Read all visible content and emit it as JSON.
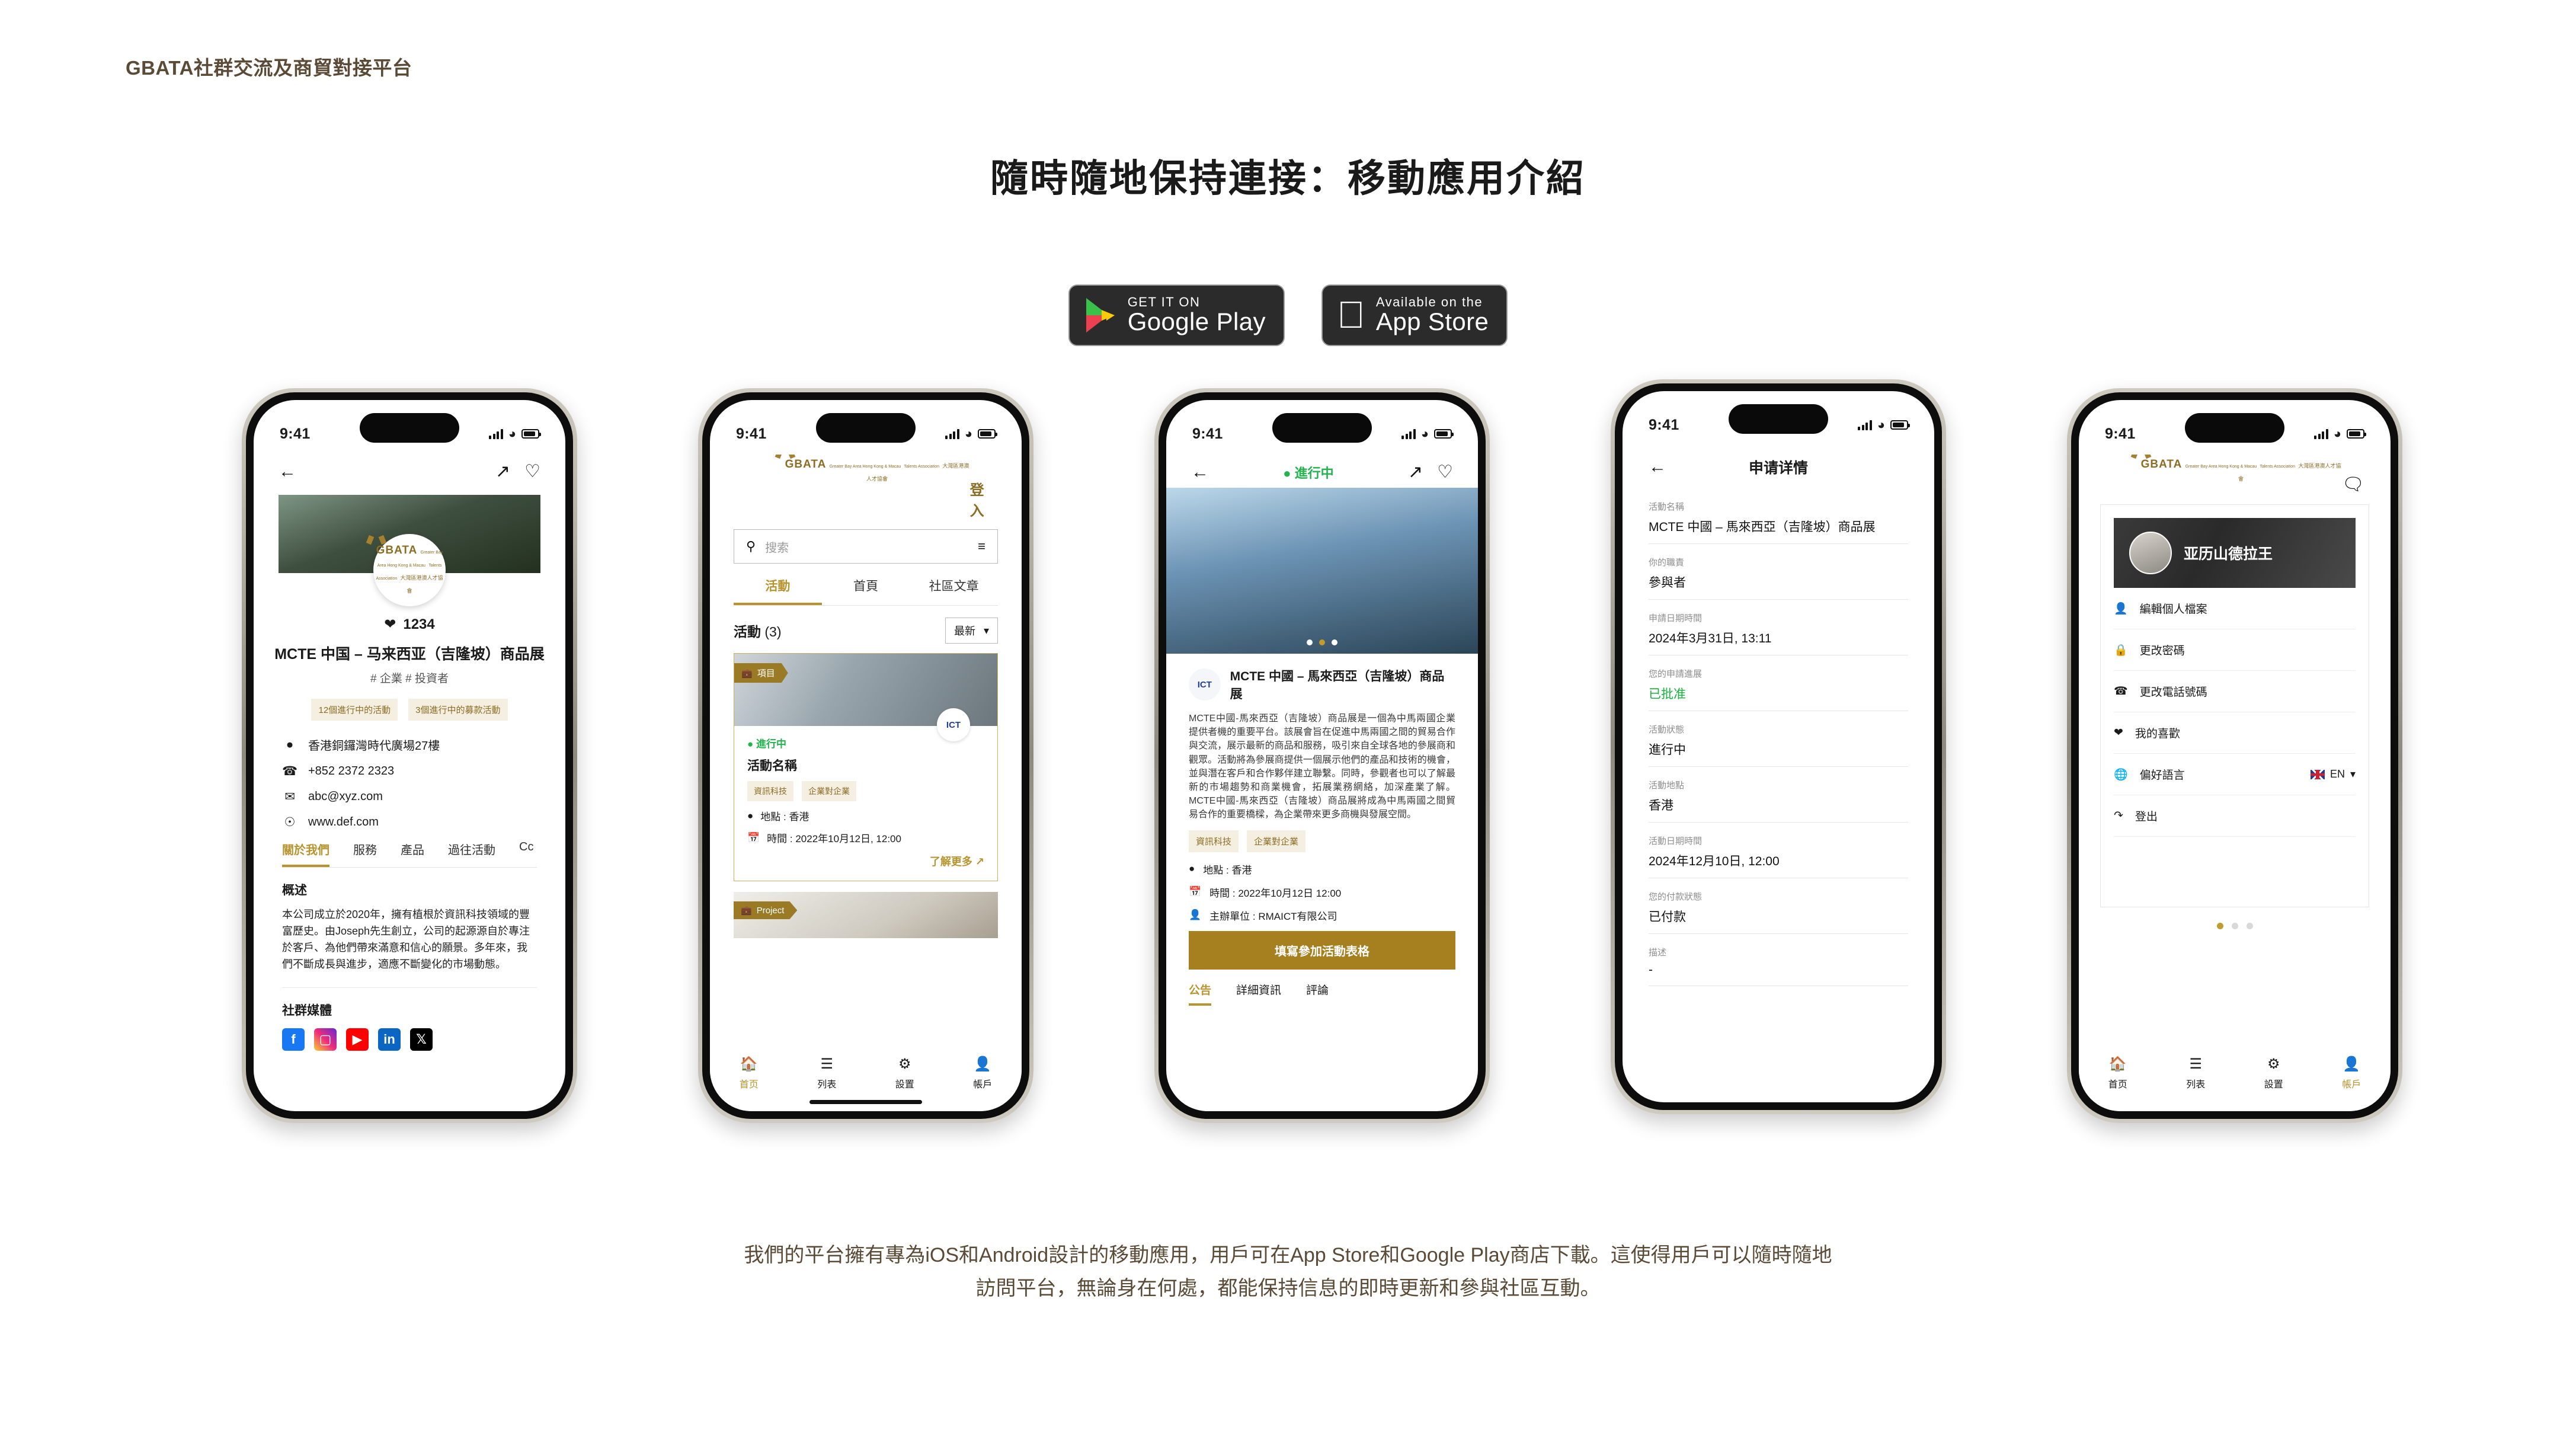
{
  "header": {
    "brand": "GBATA社群交流及商貿對接平台"
  },
  "title": "隨時隨地保持連接：移動應用介紹",
  "badges": {
    "google": {
      "small": "GET IT ON",
      "big": "Google Play"
    },
    "apple": {
      "small": "Available on the",
      "big": "App Store"
    }
  },
  "colors": {
    "brand_brown": "#5a4a36",
    "gold": "#b8942f",
    "gold_dark": "#a6801f",
    "green": "#22b44c"
  },
  "status_bar": {
    "time": "9:41"
  },
  "logo": {
    "name": "GBATA",
    "sub_line1": "Greater Bay Area Hong Kong & Macau",
    "sub_line2": "Talents Association",
    "cn": "大灣區港澳人才協會"
  },
  "phone1": {
    "likes": "1234",
    "org_title": "MCTE 中国 – 马来西亚（吉隆坡）商品展",
    "org_tags": "# 企業  # 投資者",
    "chips": [
      "12個進行中的活動",
      "3個進行中的募款活動"
    ],
    "info": [
      {
        "icon": "location-icon",
        "text": "香港銅鑼灣時代廣場27樓"
      },
      {
        "icon": "phone-icon",
        "text": "+852 2372 2323"
      },
      {
        "icon": "mail-icon",
        "text": "abc@xyz.com"
      },
      {
        "icon": "globe-icon",
        "text": "www.def.com"
      }
    ],
    "tabs": [
      "關於我們",
      "服務",
      "產品",
      "過往活動",
      "Cc"
    ],
    "section_overview": "概述",
    "overview_text": "本公司成立於2020年，擁有植根於資訊科技領域的豐富歷史。由Joseph先生創立，公司的起源源自於專注於客戶、為他們帶來滿意和信心的願景。多年來，我們不斷成長與進步，適應不斷變化的市場動態。",
    "section_social": "社群媒體",
    "socials": [
      "facebook-icon",
      "instagram-icon",
      "youtube-icon",
      "linkedin-icon",
      "x-icon"
    ]
  },
  "phone2": {
    "login": "登入",
    "search_placeholder": "搜索",
    "tabs": [
      "活動",
      "首頁",
      "社區文章"
    ],
    "list_title": "活動",
    "list_count": "(3)",
    "sort_label": "最新",
    "card": {
      "ribbon": "項目",
      "status": "進行中",
      "title": "活動名稱",
      "chips": [
        "資訊科技",
        "企業對企業"
      ],
      "location": "地點 : 香港",
      "time": "時間 : 2022年10月12日, 12:00",
      "more": "了解更多"
    },
    "card2_ribbon": "Project",
    "tabbar": [
      "首页",
      "列表",
      "設置",
      "帳戶"
    ]
  },
  "phone3": {
    "status": "進行中",
    "event_title": "MCTE 中國 – 馬來西亞（吉隆坡）商品展",
    "description": "MCTE中國-馬來西亞（吉隆坡）商品展是一個為中馬兩國企業提供者機的重要平台。該展會旨在促進中馬兩國之間的貿易合作與交流，展示最新的商品和服務，吸引來自全球各地的參展商和觀眾。活動將為參展商提供一個展示他們的產品和技術的機會，並與潛在客戶和合作夥伴建立聯繫。同時，參觀者也可以了解最新的市場趨勢和商業機會，拓展業務網絡，加深產業了解。MCTE中國-馬來西亞（吉隆坡）商品展將成為中馬兩國之間貿易合作的重要橋樑，為企業帶來更多商機與發展空間。",
    "chips": [
      "資訊科技",
      "企業對企業"
    ],
    "rows": [
      {
        "icon": "location-icon",
        "text": "地點 : 香港"
      },
      {
        "icon": "calendar-icon",
        "text": "時間 : 2022年10月12日 12:00"
      },
      {
        "icon": "person-icon",
        "text": "主辦單位 : RMAICT有限公司"
      }
    ],
    "cta": "填寫參加活動表格",
    "tabs": [
      "公告",
      "詳細資訊",
      "評論"
    ]
  },
  "phone4": {
    "title": "申请详情",
    "fields": [
      {
        "label": "活動名稱",
        "value": "MCTE 中國 – 馬來西亞（吉隆坡）商品展",
        "green": false
      },
      {
        "label": "你的職責",
        "value": "參與者",
        "green": false
      },
      {
        "label": "申請日期時間",
        "value": "2024年3月31日, 13:11",
        "green": false
      },
      {
        "label": "您的申請進展",
        "value": "已批准",
        "green": true
      },
      {
        "label": "活動狀態",
        "value": "進行中",
        "green": false
      },
      {
        "label": "活動地點",
        "value": "香港",
        "green": false
      },
      {
        "label": "活動日期時間",
        "value": "2024年12月10日, 12:00",
        "green": false
      },
      {
        "label": "您的付款狀態",
        "value": "已付款",
        "green": false
      },
      {
        "label": "描述",
        "value": "-",
        "green": false
      }
    ]
  },
  "phone5": {
    "user_name": "亚历山德拉王",
    "items": [
      {
        "icon": "person-icon",
        "label": "編輯個人檔案",
        "right": ""
      },
      {
        "icon": "lock-icon",
        "label": "更改密碼",
        "right": ""
      },
      {
        "icon": "phone-icon",
        "label": "更改電話號碼",
        "right": ""
      },
      {
        "icon": "heart-icon",
        "label": "我的喜歡",
        "right": ""
      },
      {
        "icon": "translate-icon",
        "label": "偏好語言",
        "right": "EN"
      },
      {
        "icon": "logout-icon",
        "label": "登出",
        "right": ""
      }
    ],
    "tabbar": [
      "首页",
      "列表",
      "設置",
      "帳戶"
    ]
  },
  "caption": {
    "line1": "我們的平台擁有專為iOS和Android設計的移動應用，用戶可在App Store和Google Play商店下載。這使得用戶可以隨時隨地",
    "line2": "訪問平台，無論身在何處，都能保持信息的即時更新和參與社區互動。"
  }
}
